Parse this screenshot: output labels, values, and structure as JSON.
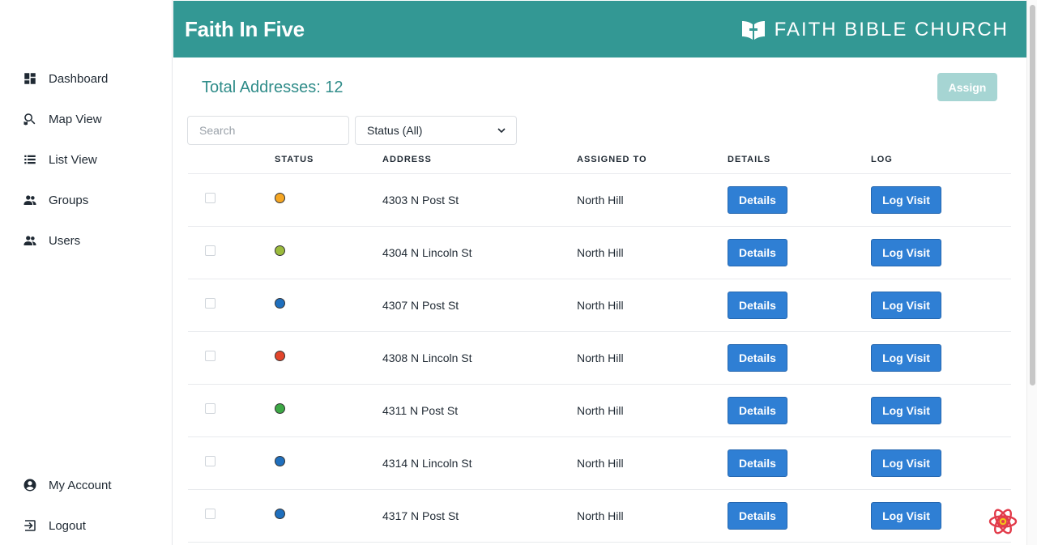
{
  "sidebar": {
    "items": [
      {
        "label": "Dashboard",
        "icon": "dashboard-icon"
      },
      {
        "label": "Map View",
        "icon": "map-search-icon"
      },
      {
        "label": "List View",
        "icon": "list-icon"
      },
      {
        "label": "Groups",
        "icon": "groups-icon"
      },
      {
        "label": "Users",
        "icon": "users-icon"
      }
    ],
    "bottom_items": [
      {
        "label": "My Account",
        "icon": "account-circle-icon"
      },
      {
        "label": "Logout",
        "icon": "logout-icon"
      }
    ]
  },
  "header": {
    "title": "Faith In Five",
    "brand": "FAITH BIBLE CHURCH",
    "brand_icon": "church-logo-icon"
  },
  "main": {
    "total_label": "Total Addresses: 12",
    "assign_label": "Assign",
    "search_placeholder": "Search",
    "status_filter": "Status (All)",
    "columns": [
      "",
      "STATUS",
      "ADDRESS",
      "ASSIGNED TO",
      "DETAILS",
      "LOG"
    ],
    "details_label": "Details",
    "log_label": "Log Visit",
    "rows": [
      {
        "status_color": "#f5a623",
        "address": "4303 N Post St",
        "assigned": "North Hill"
      },
      {
        "status_color": "#9bbb3c",
        "address": "4304 N Lincoln St",
        "assigned": "North Hill"
      },
      {
        "status_color": "#1f6fbd",
        "address": "4307 N Post St",
        "assigned": "North Hill"
      },
      {
        "status_color": "#e2452b",
        "address": "4308 N Lincoln St",
        "assigned": "North Hill"
      },
      {
        "status_color": "#3ca845",
        "address": "4311 N Post St",
        "assigned": "North Hill"
      },
      {
        "status_color": "#1f6fbd",
        "address": "4314 N Lincoln St",
        "assigned": "North Hill"
      },
      {
        "status_color": "#1f6fbd",
        "address": "4317 N Post St",
        "assigned": "North Hill"
      }
    ]
  },
  "colors": {
    "header_bg": "#339894",
    "accent_text": "#2f8c89",
    "button_primary": "#2f7fd4",
    "assign_disabled": "#a6d5d3"
  },
  "floating_icon": "react-devtools-icon"
}
